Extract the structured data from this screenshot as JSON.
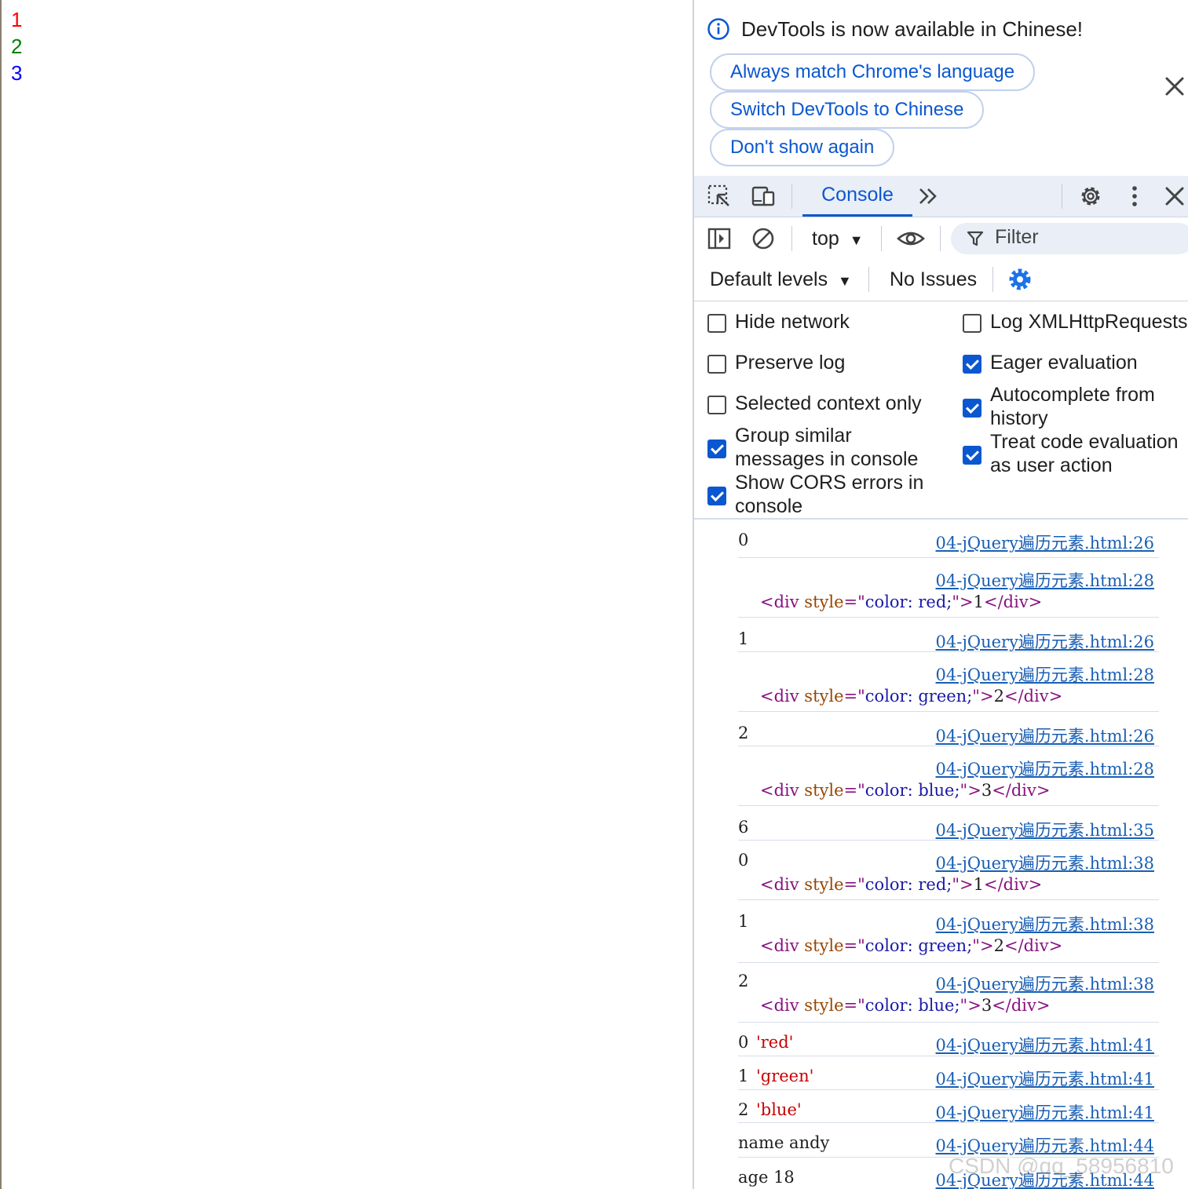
{
  "page": {
    "items": [
      {
        "text": "1",
        "color": "#ff0000"
      },
      {
        "text": "2",
        "color": "#008000"
      },
      {
        "text": "3",
        "color": "#0000ff"
      }
    ]
  },
  "infobar": {
    "message": "DevTools is now available in Chinese!",
    "buttons": [
      "Always match Chrome's language",
      "Switch DevTools to Chinese",
      "Don't show again"
    ]
  },
  "tabs": {
    "active": "Console"
  },
  "toolbar": {
    "context": "top",
    "filter_placeholder": "Filter",
    "levels": "Default levels",
    "issues": "No Issues"
  },
  "settings": {
    "left": [
      {
        "label": "Hide network",
        "checked": false
      },
      {
        "label": "Preserve log",
        "checked": false
      },
      {
        "label": "Selected context only",
        "checked": false
      },
      {
        "label": "Group similar messages in console",
        "checked": true
      },
      {
        "label": "Show CORS errors in console",
        "checked": true
      }
    ],
    "right": [
      {
        "label": "Log XMLHttpRequests",
        "checked": false
      },
      {
        "label": "Eager evaluation",
        "checked": true
      },
      {
        "label": "Autocomplete from history",
        "checked": true
      },
      {
        "label": "Treat code evaluation as user action",
        "checked": true
      }
    ]
  },
  "console": {
    "messages": [
      {
        "value": "0",
        "source": "04-jQuery遍历元素.html:26"
      },
      {
        "value": "",
        "source": "04-jQuery遍历元素.html:28",
        "html": {
          "tag_open": "<div ",
          "attr": "style",
          "eq": "=\"",
          "attr_value": "color: red;",
          "close_q": "\">",
          "text": "1",
          "tag_close": "</div>"
        }
      },
      {
        "value": "1",
        "source": "04-jQuery遍历元素.html:26"
      },
      {
        "value": "",
        "source": "04-jQuery遍历元素.html:28",
        "html": {
          "tag_open": "<div ",
          "attr": "style",
          "eq": "=\"",
          "attr_value": "color: green;",
          "close_q": "\">",
          "text": "2",
          "tag_close": "</div>"
        }
      },
      {
        "value": "2",
        "source": "04-jQuery遍历元素.html:26"
      },
      {
        "value": "",
        "source": "04-jQuery遍历元素.html:28",
        "html": {
          "tag_open": "<div ",
          "attr": "style",
          "eq": "=\"",
          "attr_value": "color: blue;",
          "close_q": "\">",
          "text": "3",
          "tag_close": "</div>"
        }
      },
      {
        "value": "6",
        "source": "04-jQuery遍历元素.html:35"
      },
      {
        "value": "0",
        "source": "04-jQuery遍历元素.html:38",
        "html": {
          "tag_open": "<div ",
          "attr": "style",
          "eq": "=\"",
          "attr_value": "color: red;",
          "close_q": "\">",
          "text": "1",
          "tag_close": "</div>"
        }
      },
      {
        "value": "1",
        "source": "04-jQuery遍历元素.html:38",
        "html": {
          "tag_open": "<div ",
          "attr": "style",
          "eq": "=\"",
          "attr_value": "color: green;",
          "close_q": "\">",
          "text": "2",
          "tag_close": "</div>"
        }
      },
      {
        "value": "2",
        "source": "04-jQuery遍历元素.html:38",
        "html": {
          "tag_open": "<div ",
          "attr": "style",
          "eq": "=\"",
          "attr_value": "color: blue;",
          "close_q": "\">",
          "text": "3",
          "tag_close": "</div>"
        }
      },
      {
        "value": "0",
        "str": "'red'",
        "source": "04-jQuery遍历元素.html:41"
      },
      {
        "value": "1",
        "str": "'green'",
        "source": "04-jQuery遍历元素.html:41"
      },
      {
        "value": "2",
        "str": "'blue'",
        "source": "04-jQuery遍历元素.html:41"
      },
      {
        "value": "name andy",
        "source": "04-jQuery遍历元素.html:44"
      },
      {
        "value": "age 18",
        "source": "04-jQuery遍历元素.html:44"
      }
    ]
  },
  "watermark": "CSDN @qq_58956810",
  "colors": {
    "accent": "#0b57d0",
    "link": "#1a5fb4",
    "tag": "#881280",
    "attr": "#994500",
    "attr_value": "#1a1aa6",
    "string": "#c80000"
  }
}
